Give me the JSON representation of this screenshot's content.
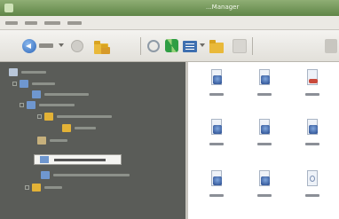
{
  "window": {
    "title": "...Manager"
  },
  "menu": [
    {
      "label": ""
    },
    {
      "label": ""
    },
    {
      "label": ""
    },
    {
      "label": ""
    }
  ],
  "toolbar": {
    "back_label": "",
    "icons": [
      "back-icon",
      "chevron-down-icon",
      "forward-icon",
      "folders-icon",
      "search-icon",
      "refresh-icon",
      "view-icon",
      "move-icon",
      "delete-icon",
      "export-icon"
    ]
  },
  "tree": {
    "items": [
      {
        "label": "",
        "icon": "desktop-icon"
      },
      {
        "label": "",
        "icon": "computer-icon"
      },
      {
        "label": "",
        "icon": "drive-icon"
      },
      {
        "label": "",
        "icon": "drive-icon"
      },
      {
        "label": "",
        "icon": "folder-icon"
      },
      {
        "label": "",
        "icon": "folder-icon"
      },
      {
        "label": "",
        "icon": "music-icon"
      },
      {
        "label": "",
        "icon": "drive-icon",
        "selected": true
      },
      {
        "label": "",
        "icon": "drive-icon"
      },
      {
        "label": "",
        "icon": "folder-icon"
      }
    ]
  },
  "files": [
    {
      "name": "",
      "kind": "image"
    },
    {
      "name": "",
      "kind": "image"
    },
    {
      "name": "",
      "kind": "doc"
    },
    {
      "name": "",
      "kind": "image"
    },
    {
      "name": "",
      "kind": "image"
    },
    {
      "name": "",
      "kind": "image"
    },
    {
      "name": "",
      "kind": "image"
    },
    {
      "name": "",
      "kind": "image"
    },
    {
      "name": "",
      "kind": "text"
    }
  ],
  "colors": {
    "titlebar": "#6f9756",
    "tree_background": "#5a5c58",
    "content_background": "#ffffff",
    "folder": "#e3b236"
  }
}
